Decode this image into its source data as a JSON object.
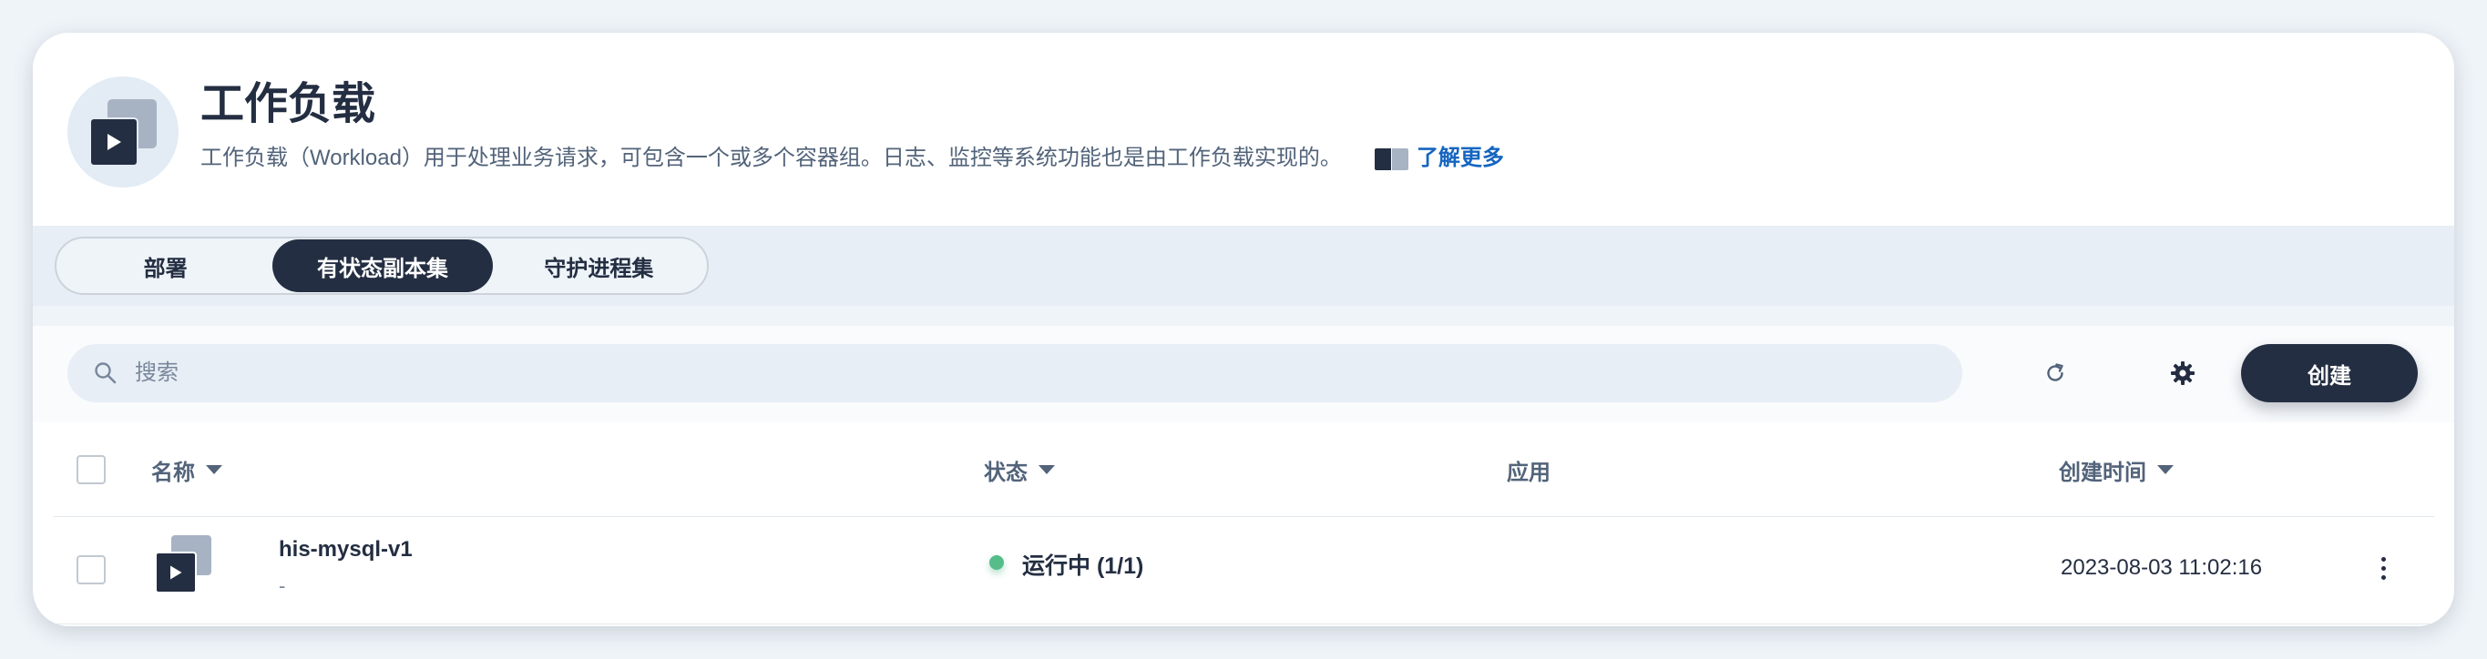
{
  "header": {
    "title": "工作负载",
    "description": "工作负载（Workload）用于处理业务请求，可包含一个或多个容器组。日志、监控等系统功能也是由工作负载实现的。",
    "learn_more": "了解更多",
    "icon": "workload-icon"
  },
  "tabs": [
    {
      "label": "部署",
      "active": false
    },
    {
      "label": "有状态副本集",
      "active": true
    },
    {
      "label": "守护进程集",
      "active": false
    }
  ],
  "toolbar": {
    "search_placeholder": "搜索",
    "search_value": "",
    "refresh_icon": "refresh-icon",
    "settings_icon": "gear-icon",
    "create_label": "创建"
  },
  "table": {
    "columns": {
      "name": "名称",
      "status": "状态",
      "app": "应用",
      "created": "创建时间"
    },
    "rows": [
      {
        "name": "his-mysql-v1",
        "subtitle": "-",
        "status": "运行中 (1/1)",
        "status_color": "#55bc8a",
        "app": "",
        "created": "2023-08-03 11:02:16"
      }
    ]
  },
  "colors": {
    "primary_dark": "#242e42",
    "link": "#1565c0",
    "success": "#55bc8a",
    "background": "#eff4f9"
  }
}
